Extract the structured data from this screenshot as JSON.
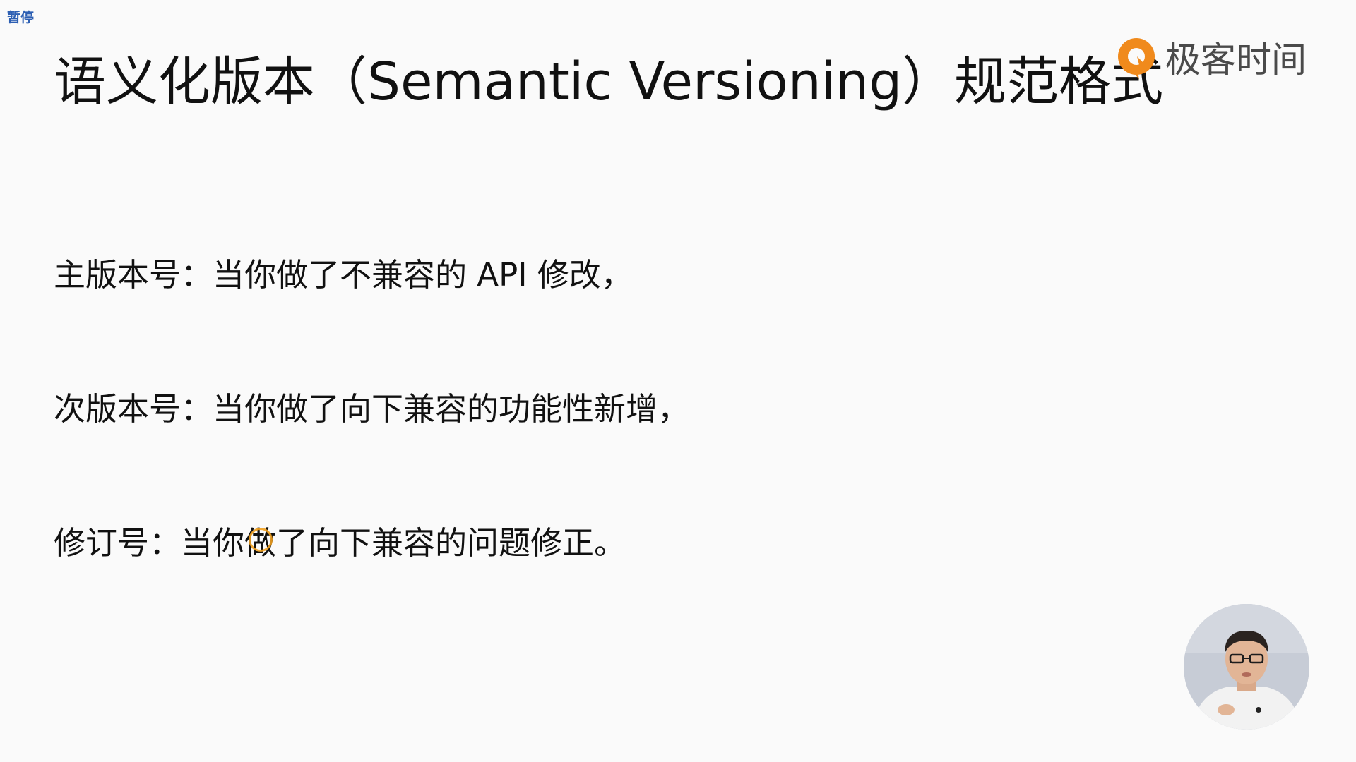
{
  "overlay": {
    "pause_label": "暂停"
  },
  "slide": {
    "title": "语义化版本（Semantic Versioning）规范格式",
    "rules": [
      "主版本号：当你做了不兼容的 API 修改，",
      "次版本号：当你做了向下兼容的功能性新增，",
      "修订号：当你做了向下兼容的问题修正。"
    ]
  },
  "brand": {
    "name": "极客时间",
    "icon": "geektime-logo-icon",
    "accent_color": "#f08a1c"
  },
  "presenter": {
    "icon": "presenter-avatar"
  }
}
